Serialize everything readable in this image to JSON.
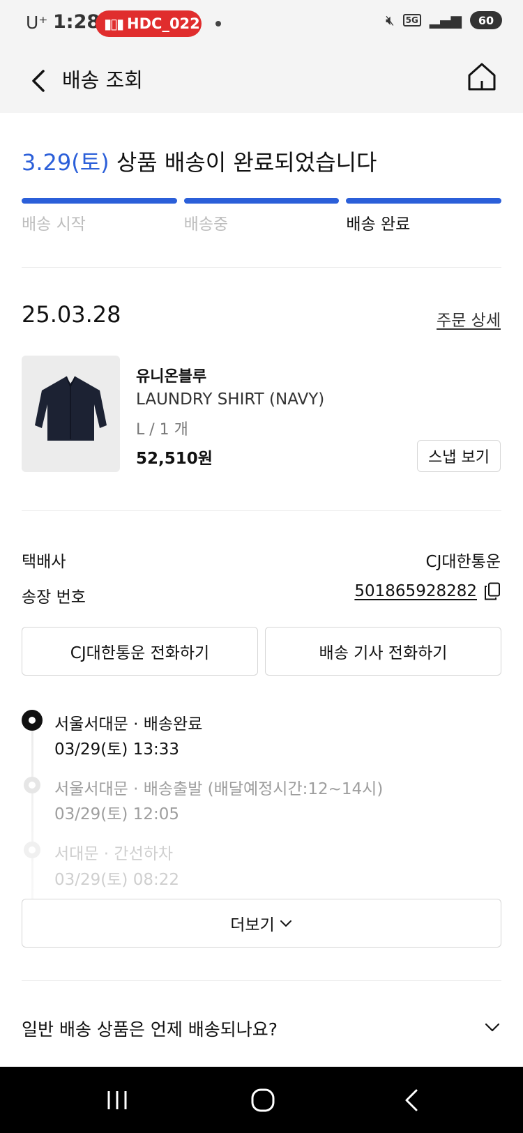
{
  "status_bar": {
    "carrier": "U⁺",
    "time": "1:28",
    "recording_label": "HDC_022",
    "network": "5G",
    "battery": "60"
  },
  "header": {
    "title": "배송 조회"
  },
  "delivery": {
    "date": "3.29(토)",
    "message": " 상품 배송이 완료되었습니다",
    "steps": [
      "배송 시작",
      "배송중",
      "배송 완료"
    ]
  },
  "order": {
    "date": "25.03.28",
    "detail_link": "주문 상세",
    "product": {
      "brand": "유니온블루",
      "name": "LAUNDRY SHIRT (NAVY)",
      "option": "L / 1 개",
      "price": "52,510원",
      "snap_button": "스냅 보기"
    }
  },
  "shipping": {
    "courier_label": "택배사",
    "courier_value": "CJ대한통운",
    "tracking_label": "송장 번호",
    "tracking_number": "501865928282",
    "call_courier": "CJ대한통운 전화하기",
    "call_driver": "배송 기사 전화하기"
  },
  "timeline": [
    {
      "title": "서울서대문 · 배송완료",
      "time": "03/29(토) 13:33"
    },
    {
      "title": "서울서대문 · 배송출발 (배달예정시간:12~14시)",
      "time": "03/29(토) 12:05"
    },
    {
      "title": "서대문 · 간선하차",
      "time": "03/29(토) 08:22"
    }
  ],
  "more_button": "더보기",
  "faq": {
    "question": "일반 배송 상품은 언제 배송되나요?"
  },
  "colors": {
    "accent": "#2b5fd9",
    "status_pill": "#e02d2d"
  }
}
